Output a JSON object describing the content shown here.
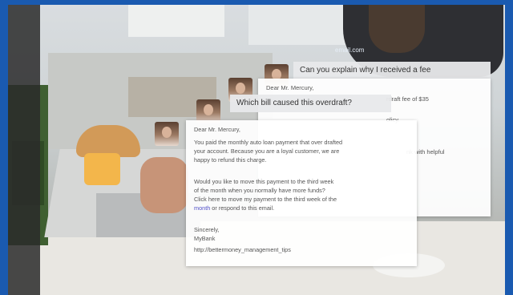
{
  "header": {
    "email_fragment": "email.com"
  },
  "back_card": {
    "question": "Can you explain why I received a fee",
    "salutation": "Dear Mr. Mercury,",
    "fragment_1": "rdraft fee of $35",
    "fragment_2": "olicy.",
    "fragment_3": "nk with helpful"
  },
  "middle_card": {
    "question": "Which bill caused this overdraft?"
  },
  "front_card": {
    "salutation": "Dear Mr. Mercury,",
    "para1": [
      "You paid the monthly auto loan payment that over drafted",
      "your account. Because you are a loyal customer, we are",
      "happy to refund this charge."
    ],
    "para2": [
      "Would you like to move this payment to the third week",
      "of the month when you normally have more funds?"
    ],
    "link": [
      "Click here to move my payment to the third week of the",
      "month"
    ],
    "link_suffix": " or respond to this email.",
    "closing": "Sincerely,",
    "signature": "MyBank",
    "tips_link": "http://bettermoney_management_tips"
  }
}
